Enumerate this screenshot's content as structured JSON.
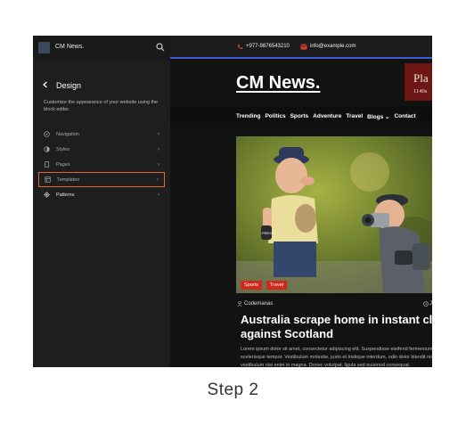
{
  "sidebar": {
    "site_name": "CM News.",
    "title": "Design",
    "description": "Customize the appearance of your website using the block editor.",
    "items": [
      {
        "label": "Navigation",
        "icon": "compass-icon",
        "chevron": "›"
      },
      {
        "label": "Styles",
        "icon": "half-circle-icon",
        "chevron": "›"
      },
      {
        "label": "Pages",
        "icon": "page-icon",
        "chevron": "›"
      },
      {
        "label": "Templates",
        "icon": "layout-icon",
        "chevron": "›"
      },
      {
        "label": "Patterns",
        "icon": "diamond-icon",
        "chevron": "›"
      }
    ],
    "highlight_color": "#e4652e"
  },
  "site": {
    "phone": "+977-9876543210",
    "email": "info@example.com",
    "logo_title": "CM News.",
    "ad_line1": "Pla",
    "ad_line2": "1140s",
    "nav": [
      "Trending",
      "Politics",
      "Sports",
      "Adventure",
      "Travel",
      "Blogs ⌄",
      "Contact"
    ],
    "tags": [
      "Sports",
      "Travel"
    ],
    "author": "Codemanas",
    "date_partial": "J",
    "headline": "Australia scrape home in instant class against Scotland",
    "excerpt": "Lorem ipsum dolor sit amet, consectetur adipiscing elit. Suspendisse eleifend fermentum scelerisque tempor. Vestibulum molestie, justo et tristique interdum, odio dolor blandit nisi, sed vestibulum nisi enim in magna. Donec volutpat, ligula sed euismod consequat.",
    "accent_blue": "#3c5bd6",
    "tag_red": "#d0281c"
  },
  "caption": "Step 2"
}
